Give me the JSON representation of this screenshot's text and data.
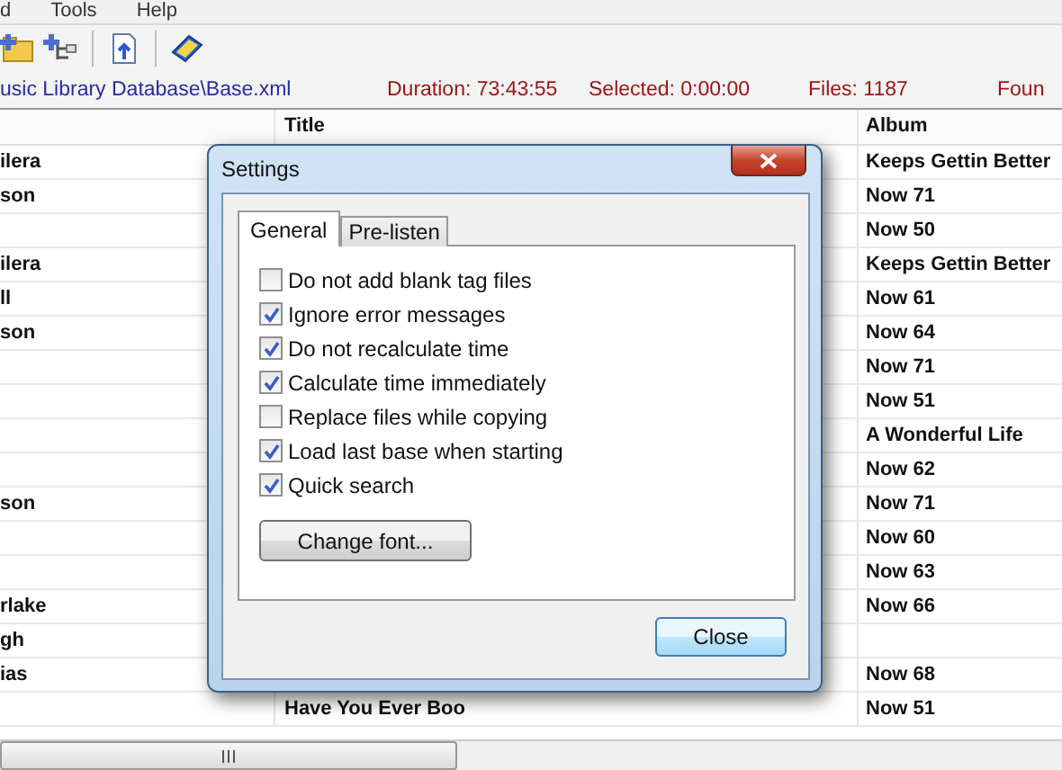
{
  "menu": [
    "d",
    "Tools",
    "Help"
  ],
  "status": {
    "path": "usic Library Database\\Base.xml",
    "duration": "Duration: 73:43:55",
    "selected": "Selected: 0:00:00",
    "files": "Files: 1187",
    "found": "Foun"
  },
  "table": {
    "columns": [
      "Title",
      "Album"
    ],
    "rows": [
      {
        "artist": "ilera",
        "album": "Keeps Gettin Better"
      },
      {
        "artist": "son",
        "album": "Now 71"
      },
      {
        "album": "Now 50"
      },
      {
        "artist": "ilera",
        "album": "Keeps Gettin Better"
      },
      {
        "artist": "ll",
        "album": "Now 61"
      },
      {
        "artist": "son",
        "album": "Now 64"
      },
      {
        "album": "Now 71"
      },
      {
        "album": "Now 51"
      },
      {
        "album": "A Wonderful Life"
      },
      {
        "album": "Now 62"
      },
      {
        "artist": "son",
        "album": "Now 71"
      },
      {
        "album": "Now 60"
      },
      {
        "album": "Now 63"
      },
      {
        "artist": "rlake",
        "album": "Now 66"
      },
      {
        "artist": "gh"
      },
      {
        "artist": "ias",
        "album": "Now 68"
      },
      {
        "title": "Have You Ever Boo",
        "album": "Now 51"
      }
    ]
  },
  "dialog": {
    "title": "Settings",
    "tabs": [
      {
        "label": "General",
        "selected": true
      },
      {
        "label": "Pre-listen",
        "selected": false
      }
    ],
    "options": [
      {
        "label": "Do not add blank tag files",
        "checked": false
      },
      {
        "label": "Ignore error messages",
        "checked": true
      },
      {
        "label": "Do not recalculate time",
        "checked": true
      },
      {
        "label": "Calculate time immediately",
        "checked": true
      },
      {
        "label": "Replace files while copying",
        "checked": false
      },
      {
        "label": "Load last base when starting",
        "checked": true
      },
      {
        "label": "Quick search",
        "checked": true
      }
    ],
    "font_button": "Change font...",
    "close_button": "Close"
  }
}
